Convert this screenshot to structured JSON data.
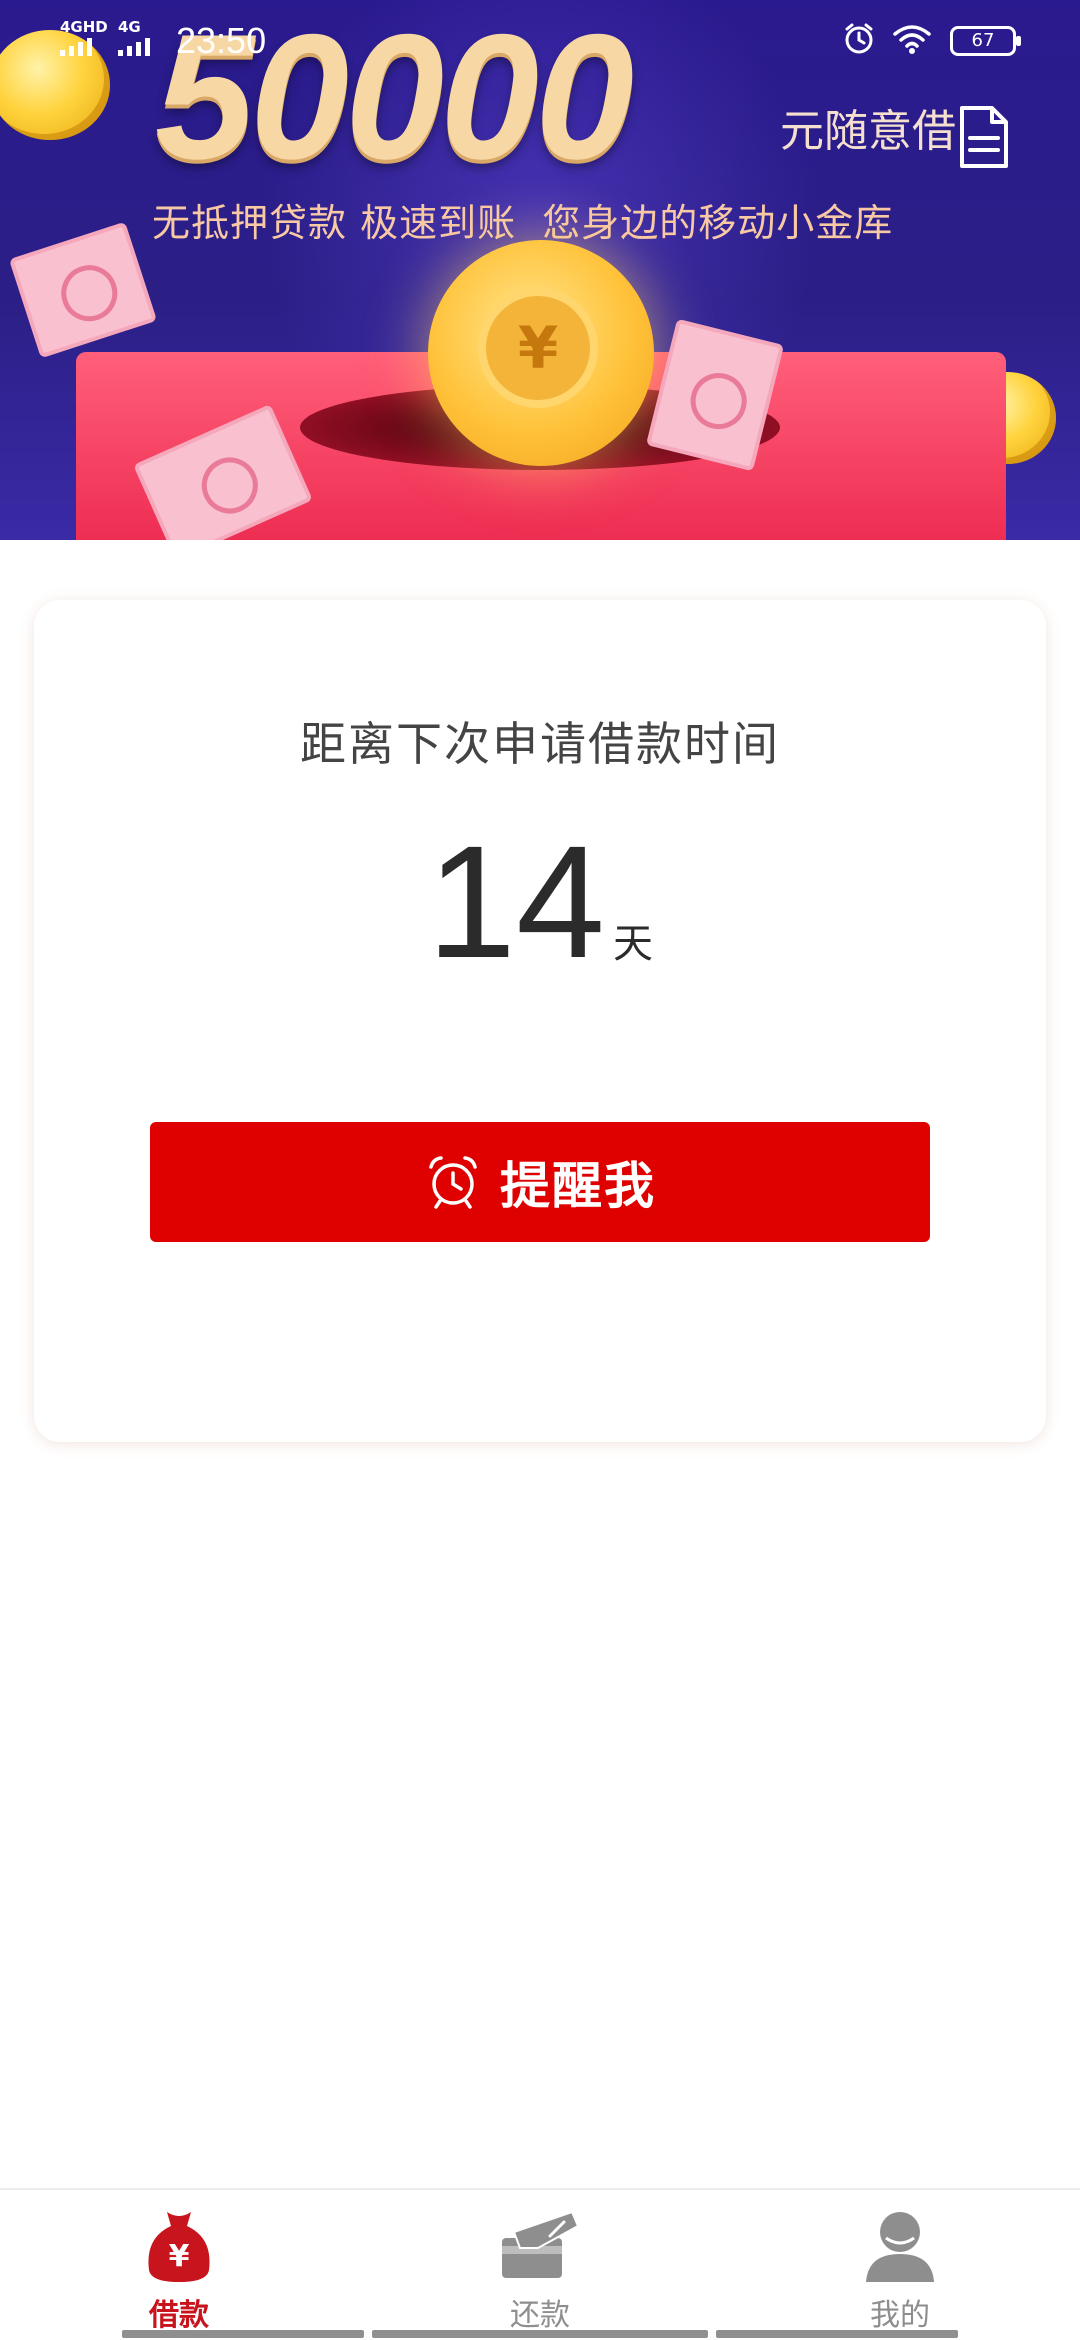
{
  "status_bar": {
    "signal_1": "4GHD",
    "signal_2": "4G",
    "time": "23:50",
    "battery": "67"
  },
  "banner": {
    "amount": "50000",
    "amount_suffix": "元随意借",
    "slogan": "无抵押贷款 极速到账  您身边的移动小金库",
    "coin_symbol": "¥"
  },
  "card": {
    "label": "距离下次申请借款时间",
    "days": "14",
    "unit": "天",
    "remind_button": "提醒我"
  },
  "bottom_nav": {
    "items": [
      {
        "label": "借款",
        "icon": "money-bag-icon",
        "active": true
      },
      {
        "label": "还款",
        "icon": "card-pen-icon",
        "active": false
      },
      {
        "label": "我的",
        "icon": "person-icon",
        "active": false
      }
    ]
  },
  "colors": {
    "primary_red": "#df0000",
    "active_nav": "#c8141c",
    "inactive_nav": "#8e8e8e",
    "banner_bg": "#2a1a8f"
  }
}
